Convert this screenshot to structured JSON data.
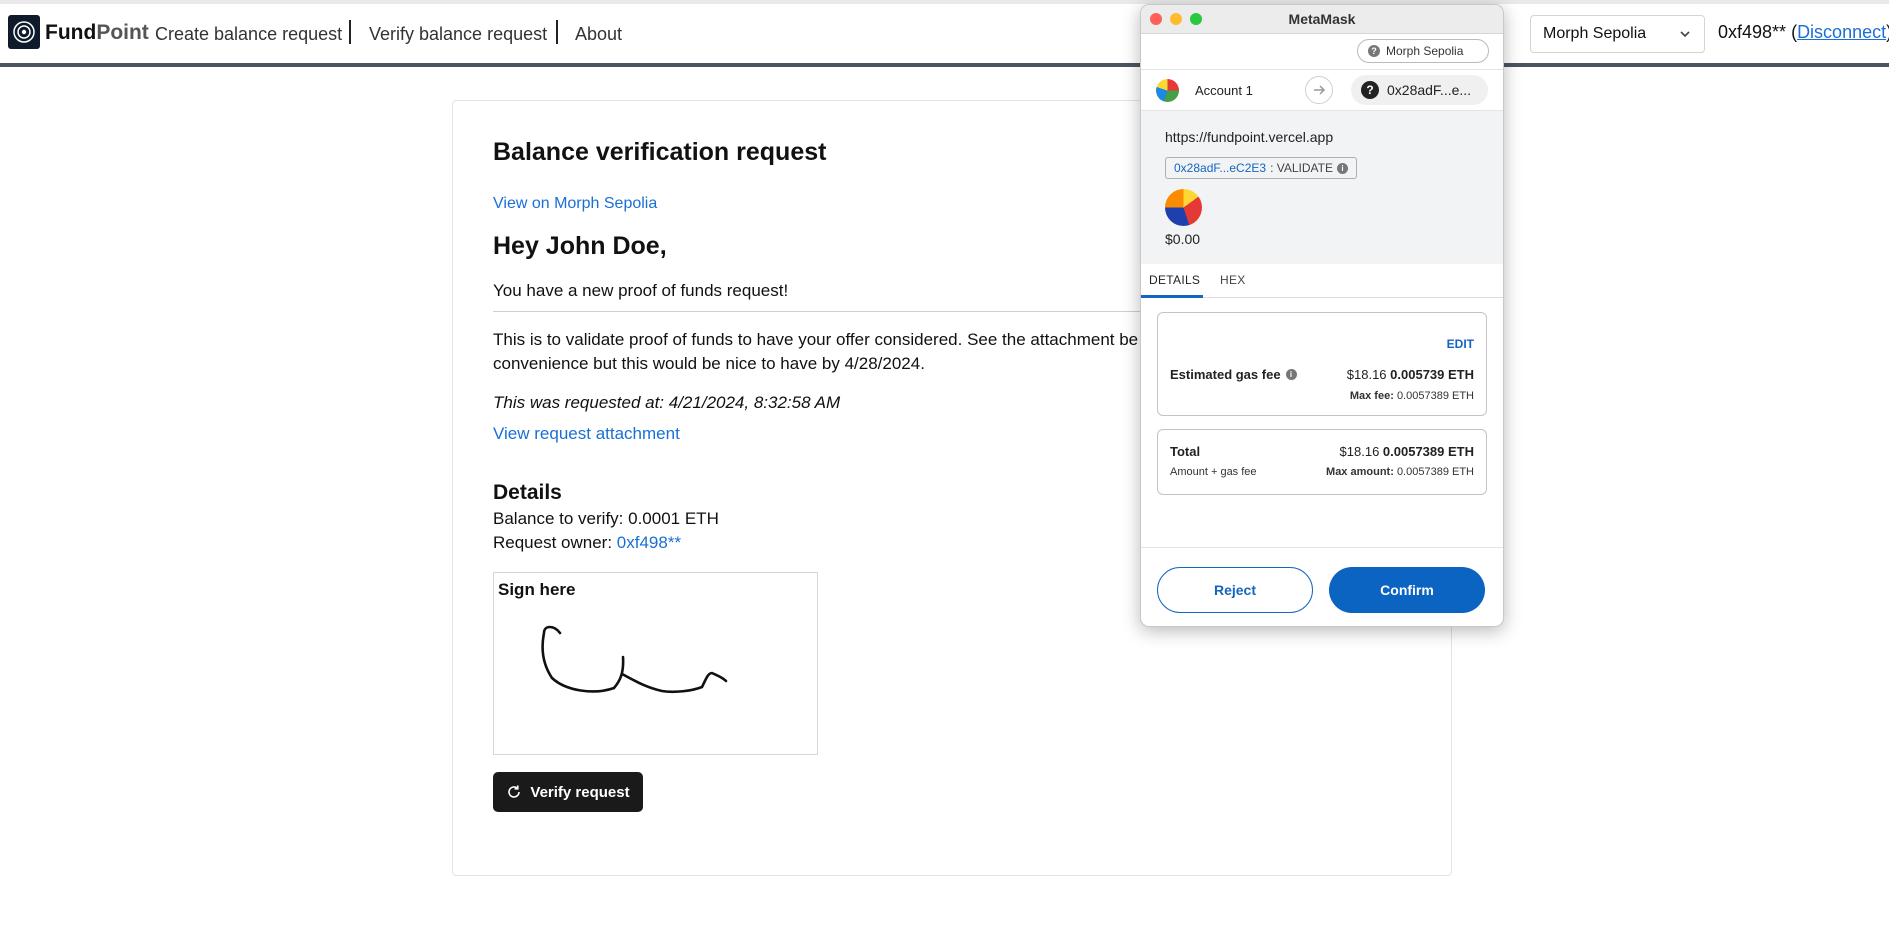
{
  "header": {
    "brand_bold": "Fund",
    "brand_rest": "Point",
    "nav": [
      "Create balance request",
      "Verify balance request",
      "About"
    ],
    "network": "Morph Sepolia",
    "address": "0xf498**",
    "disconnect": "Disconnect"
  },
  "card": {
    "title": "Balance verification request",
    "explorer_link": "View on Morph Sepolia",
    "greeting": "Hey John Doe,",
    "subtitle": "You have a new proof of funds request!",
    "body_line1": "This is to validate proof of funds to have your offer considered. See the attachment be",
    "body_line2": "convenience but this would be nice to have by 4/28/2024.",
    "requested": "This was requested at: 4/21/2024, 8:32:58 AM",
    "attachment_link": "View request attachment",
    "details_heading": "Details",
    "balance_label": "Balance to verify: ",
    "balance_value": "0.0001 ETH",
    "owner_label": "Request owner: ",
    "owner_value": "0xf498**",
    "sign_label": "Sign here",
    "verify_button": "Verify request"
  },
  "metamask": {
    "window_title": "MetaMask",
    "network": "Morph Sepolia",
    "account": "Account 1",
    "to_address": "0x28adF...e...",
    "origin": "https://fundpoint.vercel.app",
    "contract": "0x28adF...eC2E3",
    "method": ": VALIDATE",
    "amount": "$0.00",
    "tabs": [
      "DETAILS",
      "HEX"
    ],
    "edit": "EDIT",
    "gas_label": "Estimated gas fee",
    "gas_usd": "$18.16",
    "gas_eth": "0.005739 ETH",
    "max_fee_label": "Max fee:",
    "max_fee_value": "0.0057389 ETH",
    "total_label": "Total",
    "total_usd": "$18.16",
    "total_eth": "0.0057389 ETH",
    "total_sub": "Amount + gas fee",
    "max_amount_label": "Max amount:",
    "max_amount_value": "0.0057389 ETH",
    "reject": "Reject",
    "confirm": "Confirm"
  },
  "colors": {
    "link": "#1a6fd6",
    "header_rule": "#4a5560",
    "mm_primary": "#0b63c2",
    "button_dark": "#1a1a1a"
  }
}
